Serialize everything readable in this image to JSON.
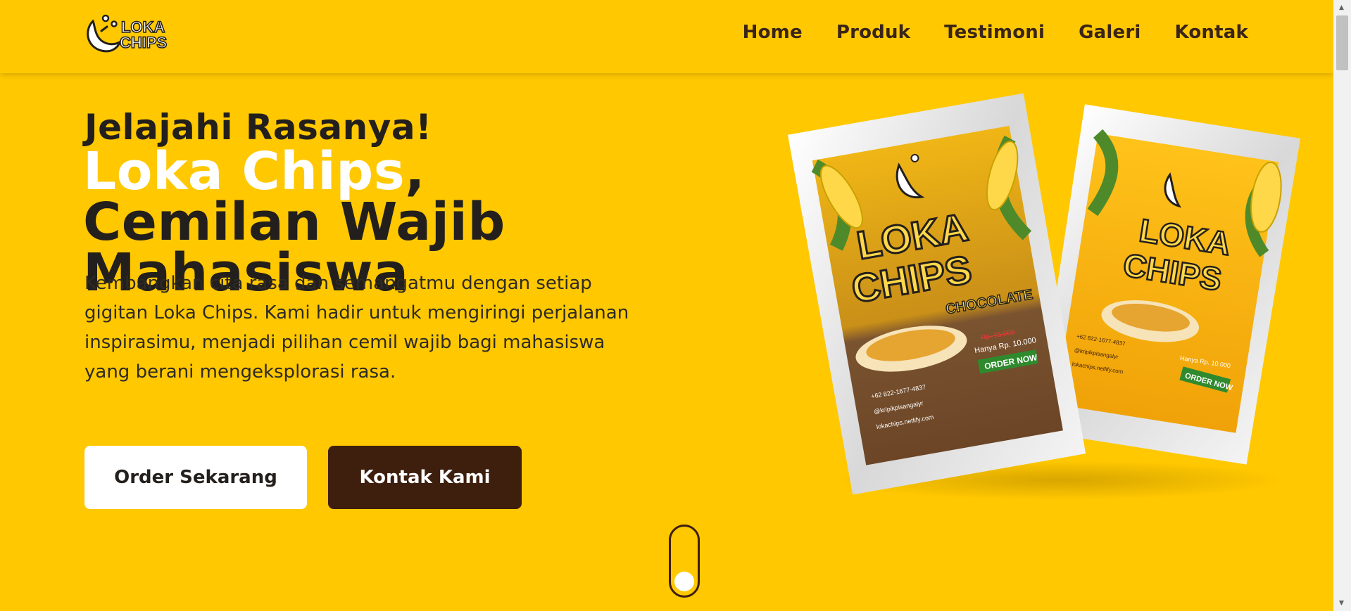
{
  "brand": {
    "logo_line1": "LOKA",
    "logo_line2": "CHIPS"
  },
  "nav": {
    "items": [
      {
        "label": "Home"
      },
      {
        "label": "Produk"
      },
      {
        "label": "Testimoni"
      },
      {
        "label": "Galeri"
      },
      {
        "label": "Kontak"
      }
    ]
  },
  "hero": {
    "eyebrow": "Jelajahi Rasanya!",
    "title_brand": "Loka Chips",
    "title_rest": ", Cemilan Wajib Mahasiswa",
    "description": "Kembangkan cita rasa dan semangatmu dengan setiap gigitan Loka Chips. Kami hadir untuk mengiringi perjalanan inspirasimu, menjadi pilihan cemil wajib bagi mahasiswa yang berani mengeksplorasi rasa.",
    "order_button": "Order Sekarang",
    "contact_button": "Kontak Kami"
  },
  "product_image": {
    "brand_line1": "LOKA",
    "brand_line2": "CHIPS",
    "flavor_label": "CHOCOLATE",
    "old_price": "Rp. 15.000",
    "new_price": "Hanya Rp. 10.000",
    "order_now": "ORDER NOW",
    "phone": "+62 822-1677-4837",
    "instagram": "@kripikpisangalyr",
    "website": "lokachips.netlify.com"
  },
  "colors": {
    "background": "#FFC800",
    "dark_brown": "#3e1f0e",
    "text_dark": "#231f1c",
    "white": "#ffffff"
  }
}
